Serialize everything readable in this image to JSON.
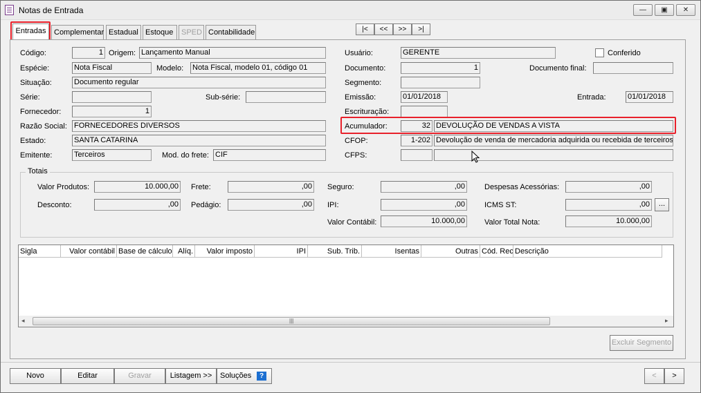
{
  "window": {
    "title": "Notas de Entrada",
    "btn_min": "▭",
    "btn_max": "▣",
    "btn_close": "✕"
  },
  "tabs": [
    "Entradas",
    "Complementar",
    "Estadual",
    "Estoque",
    "SPED",
    "Contabilidade"
  ],
  "nav": {
    "first": "|<",
    "prev": "<<",
    "next": ">>",
    "last": ">|"
  },
  "form": {
    "codigo_label": "Código:",
    "codigo": "1",
    "origem_label": "Origem:",
    "origem": "Lançamento Manual",
    "especie_label": "Espécie:",
    "especie": "Nota Fiscal",
    "modelo_label": "Modelo:",
    "modelo": "Nota Fiscal, modelo 01, código 01",
    "situacao_label": "Situação:",
    "situacao": "Documento regular",
    "serie_label": "Série:",
    "serie": "",
    "subserie_label": "Sub-série:",
    "subserie": "",
    "fornecedor_label": "Fornecedor:",
    "fornecedor": "1",
    "razao_label": "Razão Social:",
    "razao": "FORNECEDORES DIVERSOS",
    "estado_label": "Estado:",
    "estado": "SANTA CATARINA",
    "emitente_label": "Emitente:",
    "emitente": "Terceiros",
    "frete_label": "Mod. do frete:",
    "frete": "CIF",
    "usuario_label": "Usuário:",
    "usuario": "GERENTE",
    "conferido_label": "Conferido",
    "documento_label": "Documento:",
    "documento": "1",
    "docfinal_label": "Documento final:",
    "docfinal": "",
    "segmento_label": "Segmento:",
    "segmento": "",
    "emissao_label": "Emissão:",
    "emissao": "01/01/2018",
    "entrada_label": "Entrada:",
    "entrada": "01/01/2018",
    "escrituracao_label": "Escrituração:",
    "escrituracao": "",
    "acumulador_label": "Acumulador:",
    "acumulador_cod": "32",
    "acumulador_desc": "DEVOLUÇÃO DE VENDAS A VISTA",
    "cfop_label": "CFOP:",
    "cfop_cod": "1-202",
    "cfop_desc": "Devolução de venda de mercadoria adquirida ou recebida de terceiros",
    "cfps_label": "CFPS:",
    "cfps_cod": "",
    "cfps_desc": ""
  },
  "totais": {
    "title": "Totais",
    "valor_produtos_label": "Valor Produtos:",
    "valor_produtos": "10.000,00",
    "desconto_label": "Desconto:",
    "desconto": ",00",
    "frete_label": "Frete:",
    "frete": ",00",
    "pedagio_label": "Pedágio:",
    "pedagio": ",00",
    "seguro_label": "Seguro:",
    "seguro": ",00",
    "ipi_label": "IPI:",
    "ipi": ",00",
    "valor_contabil_label": "Valor Contábil:",
    "valor_contabil": "10.000,00",
    "despesas_label": "Despesas Acessórias:",
    "despesas": ",00",
    "icms_st_label": "ICMS ST:",
    "icms_st": ",00",
    "valor_total_label": "Valor Total Nota:",
    "valor_total": "10.000,00",
    "ellipsis": "..."
  },
  "grid": {
    "columns": [
      "Sigla",
      "Valor contábil",
      "Base de cálculo",
      "Alíq.",
      "Valor imposto",
      "IPI",
      "Sub. Trib.",
      "Isentas",
      "Outras",
      "Cód. Rec.",
      "Descrição"
    ]
  },
  "excluir_segmento": "Excluir Segmento",
  "bottom": {
    "novo": "Novo",
    "editar": "Editar",
    "gravar": "Gravar",
    "listagem": "Listagem >>",
    "solucoes": "Soluções",
    "help": "?",
    "prev": "<",
    "next": ">"
  }
}
